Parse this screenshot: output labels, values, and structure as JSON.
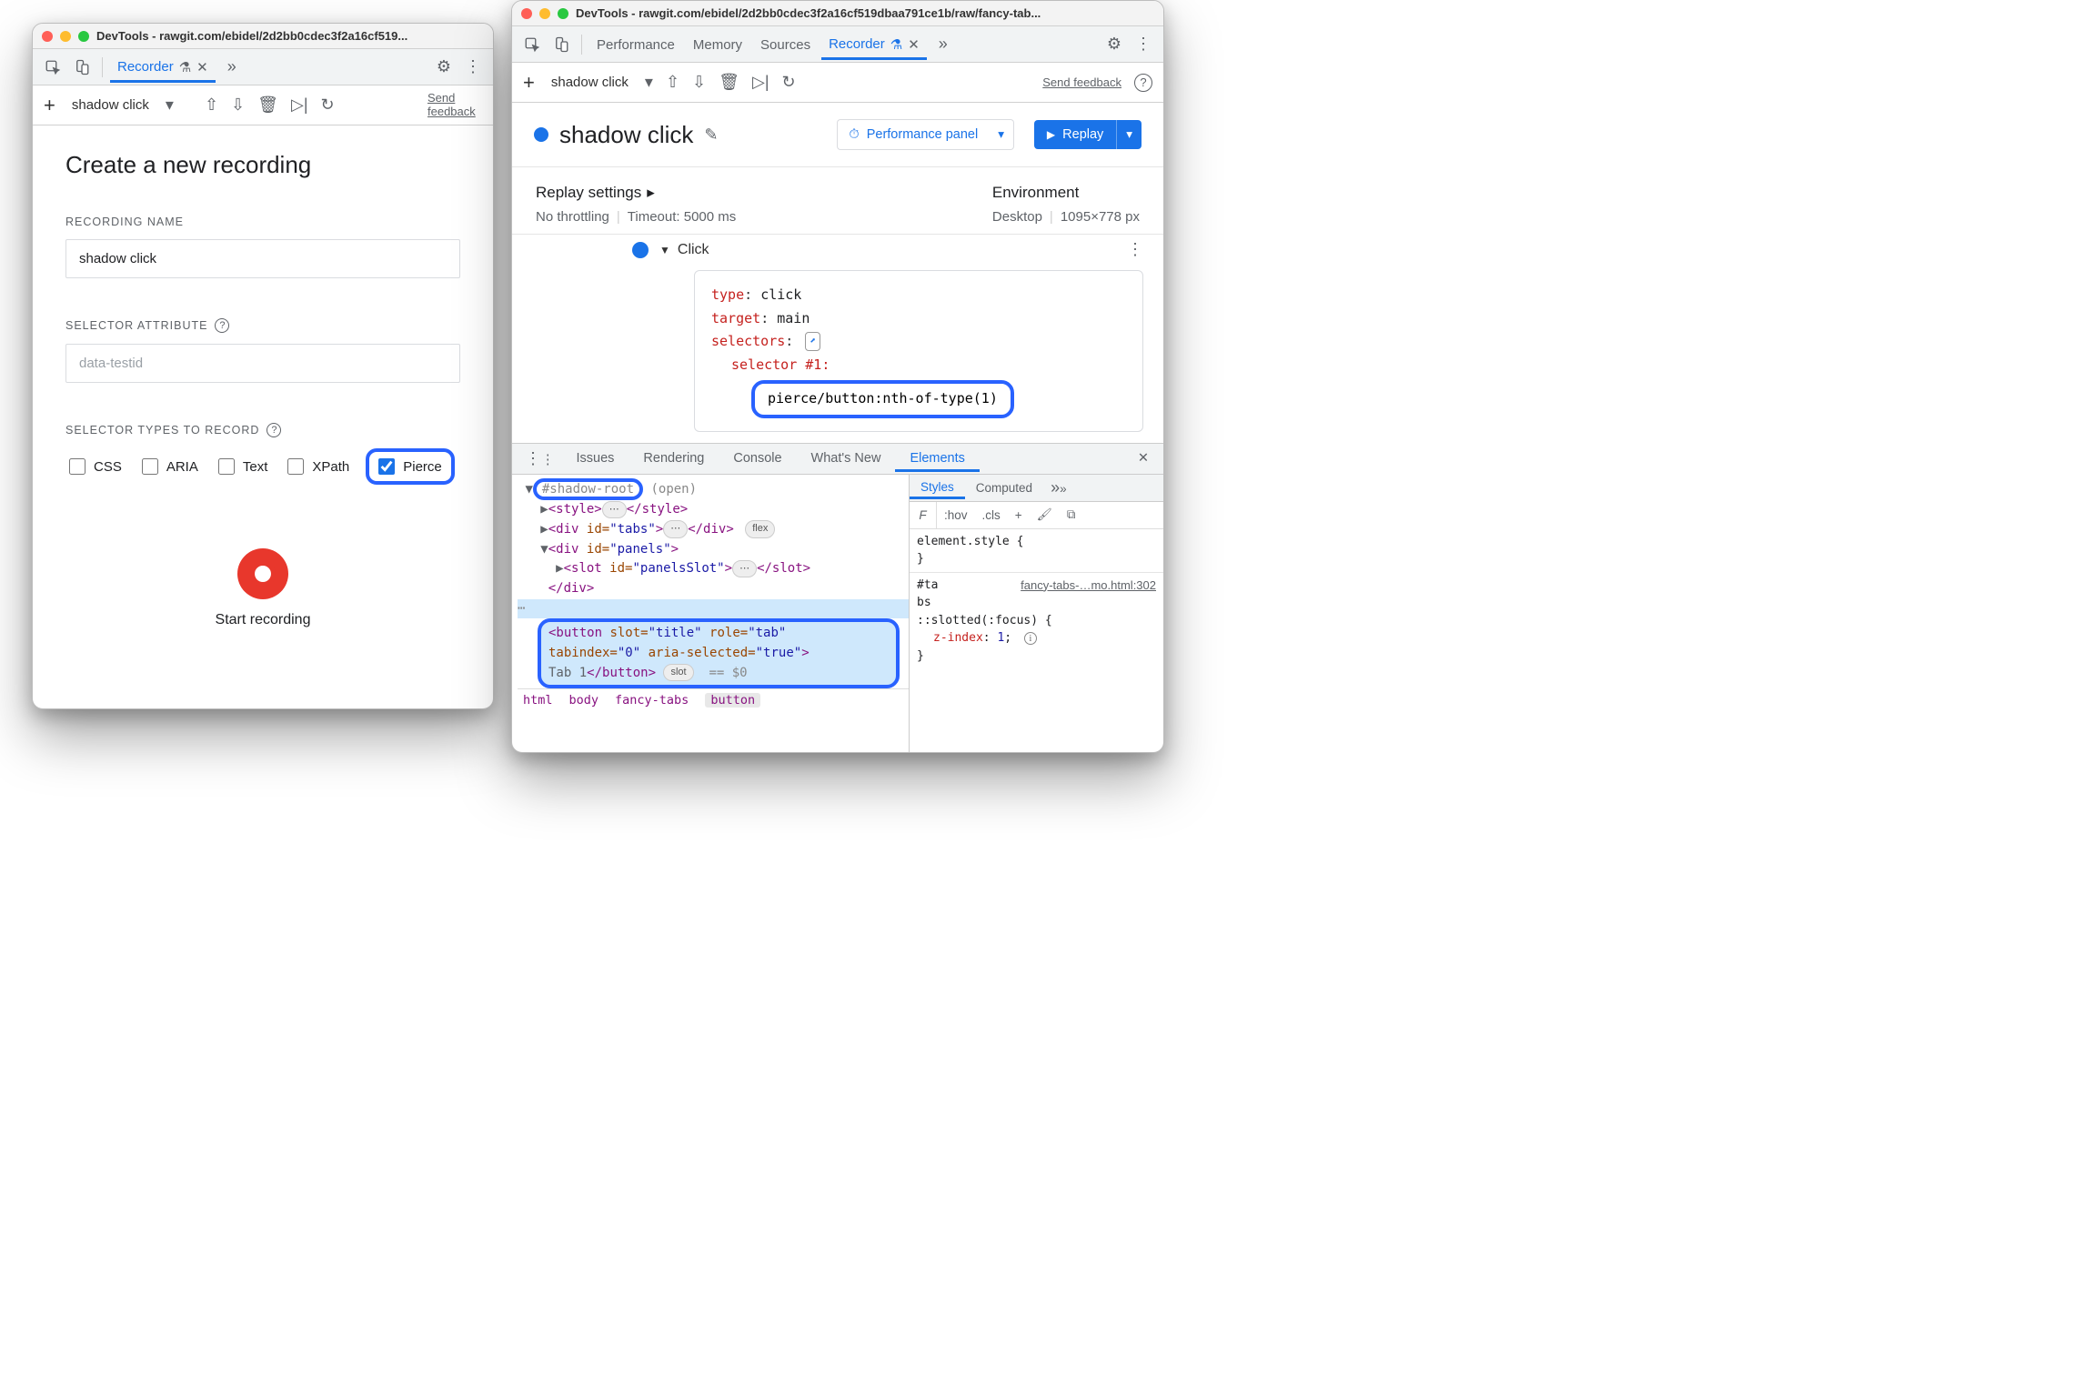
{
  "window1": {
    "title": "DevTools - rawgit.com/ebidel/2d2bb0cdec3f2a16cf519...",
    "tabs": {
      "recorder": "Recorder"
    },
    "toolbar": {
      "name": "shadow click",
      "send": "Send feedback"
    },
    "form": {
      "heading": "Create a new recording",
      "recording_name_label": "RECORDING NAME",
      "recording_name_value": "shadow click",
      "selector_attr_label": "SELECTOR ATTRIBUTE",
      "selector_attr_placeholder": "data-testid",
      "selector_types_label": "SELECTOR TYPES TO RECORD",
      "types": {
        "css": "CSS",
        "aria": "ARIA",
        "text": "Text",
        "xpath": "XPath",
        "pierce": "Pierce"
      },
      "start": "Start recording"
    }
  },
  "window2": {
    "title": "DevTools - rawgit.com/ebidel/2d2bb0cdec3f2a16cf519dbaa791ce1b/raw/fancy-tab...",
    "tabs": {
      "performance": "Performance",
      "memory": "Memory",
      "sources": "Sources",
      "recorder": "Recorder"
    },
    "toolbar": {
      "name": "shadow click",
      "send": "Send feedback"
    },
    "header": {
      "rec_title": "shadow click",
      "perf_btn": "Performance panel",
      "replay": "Replay"
    },
    "settings": {
      "replay_head": "Replay settings",
      "throttling": "No throttling",
      "timeout": "Timeout: 5000 ms",
      "env_head": "Environment",
      "device": "Desktop",
      "viewport": "1095×778 px"
    },
    "step": {
      "title": "Click",
      "lines": {
        "type_k": "type",
        "type_v": "click",
        "target_k": "target",
        "target_v": "main",
        "selectors_k": "selectors",
        "sel_num": "selector #1",
        "sel_val": "pierce/button:nth-of-type(1)"
      }
    },
    "drawer": {
      "tabs": {
        "issues": "Issues",
        "rendering": "Rendering",
        "console": "Console",
        "whatsnew": "What's New",
        "elements": "Elements"
      },
      "dom": {
        "shadow_root": "#shadow-root",
        "open": "(open)",
        "style_open": "<style>",
        "style_close": "</style>",
        "div_tabs_open": "<div id=\"tabs\">",
        "div_tabs_close": "</div>",
        "flex": "flex",
        "div_panels_open": "<div id=\"panels\">",
        "slot_open": "<slot id=\"panelsSlot\">",
        "slot_close": "</slot>",
        "div_close": "</div>",
        "btn_line1": "<button slot=\"title\" role=\"tab\"",
        "btn_line2": "tabindex=\"0\" aria-selected=\"true\">",
        "btn_text": "Tab 1",
        "btn_close": "</button>",
        "slot_pill": "slot",
        "eq0": "== $0"
      },
      "crumbs": {
        "html": "html",
        "body": "body",
        "fancy": "fancy-tabs",
        "button": "button"
      },
      "styles": {
        "tabs": {
          "styles": "Styles",
          "computed": "Computed"
        },
        "filter_F": "F",
        "hov": ":hov",
        "cls": ".cls",
        "plus": "+",
        "element_style": "element.style {",
        "close": "}",
        "sel2": "#ta\nbs",
        "src": "fancy-tabs-…mo.html:302",
        "slotted": "::slotted(:focus) {",
        "zidx_k": "z-index",
        "zidx_v": "1"
      }
    }
  }
}
